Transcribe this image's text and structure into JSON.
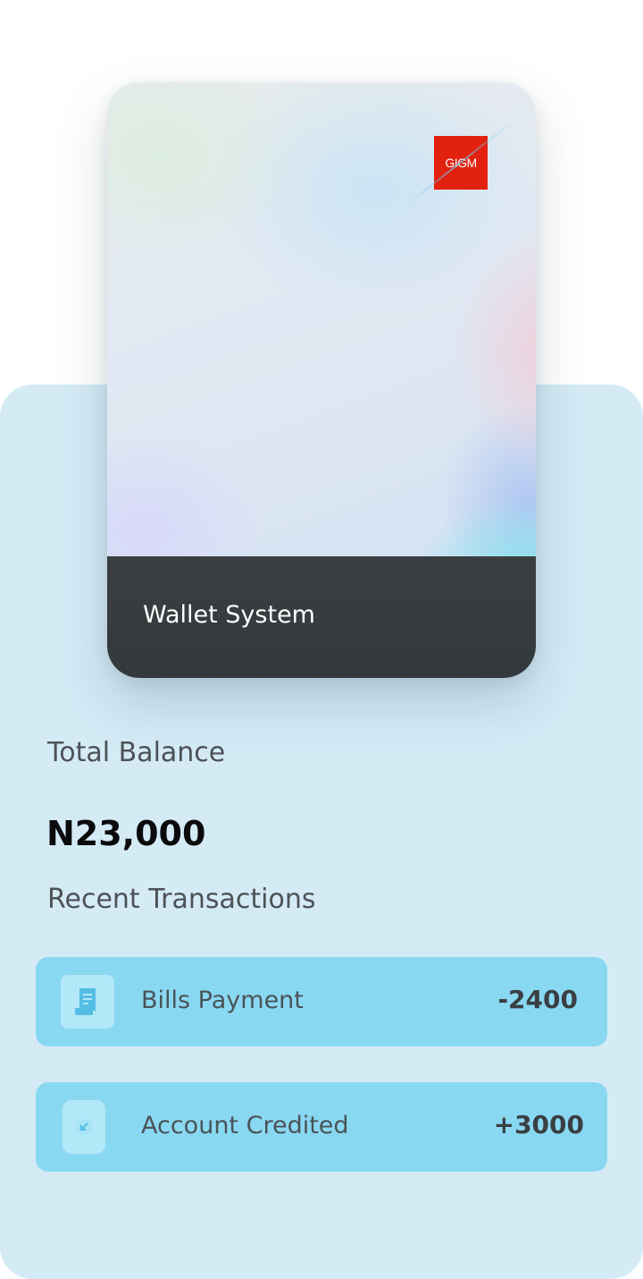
{
  "card": {
    "logo_text": "GIGM",
    "title": "Wallet System"
  },
  "balance": {
    "label": "Total Balance",
    "amount": "N23,000"
  },
  "transactions": {
    "heading": "Recent Transactions",
    "items": [
      {
        "label": "Bills Payment",
        "amount": "-2400",
        "icon": "receipt-icon"
      },
      {
        "label": "Account Credited",
        "amount": "+3000",
        "icon": "credit-arrow-icon"
      }
    ]
  },
  "colors": {
    "panel": "#d4ebf6",
    "transaction_row": "#89d8f2",
    "logo": "#e3210f",
    "card_bottom": "#35393c"
  }
}
